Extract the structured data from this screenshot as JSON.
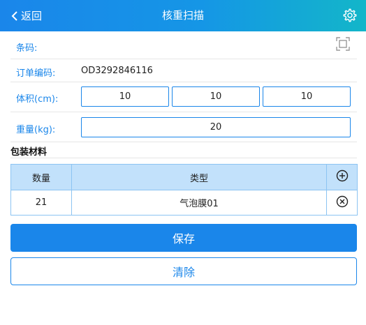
{
  "header": {
    "back_label": "返回",
    "title": "核重扫描",
    "settings_icon": "gear-icon"
  },
  "form": {
    "barcode_label": "条码:",
    "barcode_value": "",
    "scan_icon": "scan-icon",
    "order_label": "订单编码:",
    "order_value": "OD3292846116",
    "volume_label": "体积(cm):",
    "volume_length": "10",
    "volume_width": "10",
    "volume_height": "10",
    "weight_label": "重量(kg):",
    "weight_value": "20"
  },
  "packaging": {
    "section_title": "包装材料",
    "columns": [
      "数量",
      "类型"
    ],
    "add_icon": "add-circle-icon",
    "rows": [
      {
        "quantity": "21",
        "type": "气泡膜01",
        "remove_icon": "remove-circle-icon"
      }
    ]
  },
  "actions": {
    "save_label": "保存",
    "clear_label": "清除"
  },
  "colors": {
    "accent": "#1a86ea",
    "header_gradient_end": "#13b6c9",
    "table_header": "#c2e1fb"
  }
}
